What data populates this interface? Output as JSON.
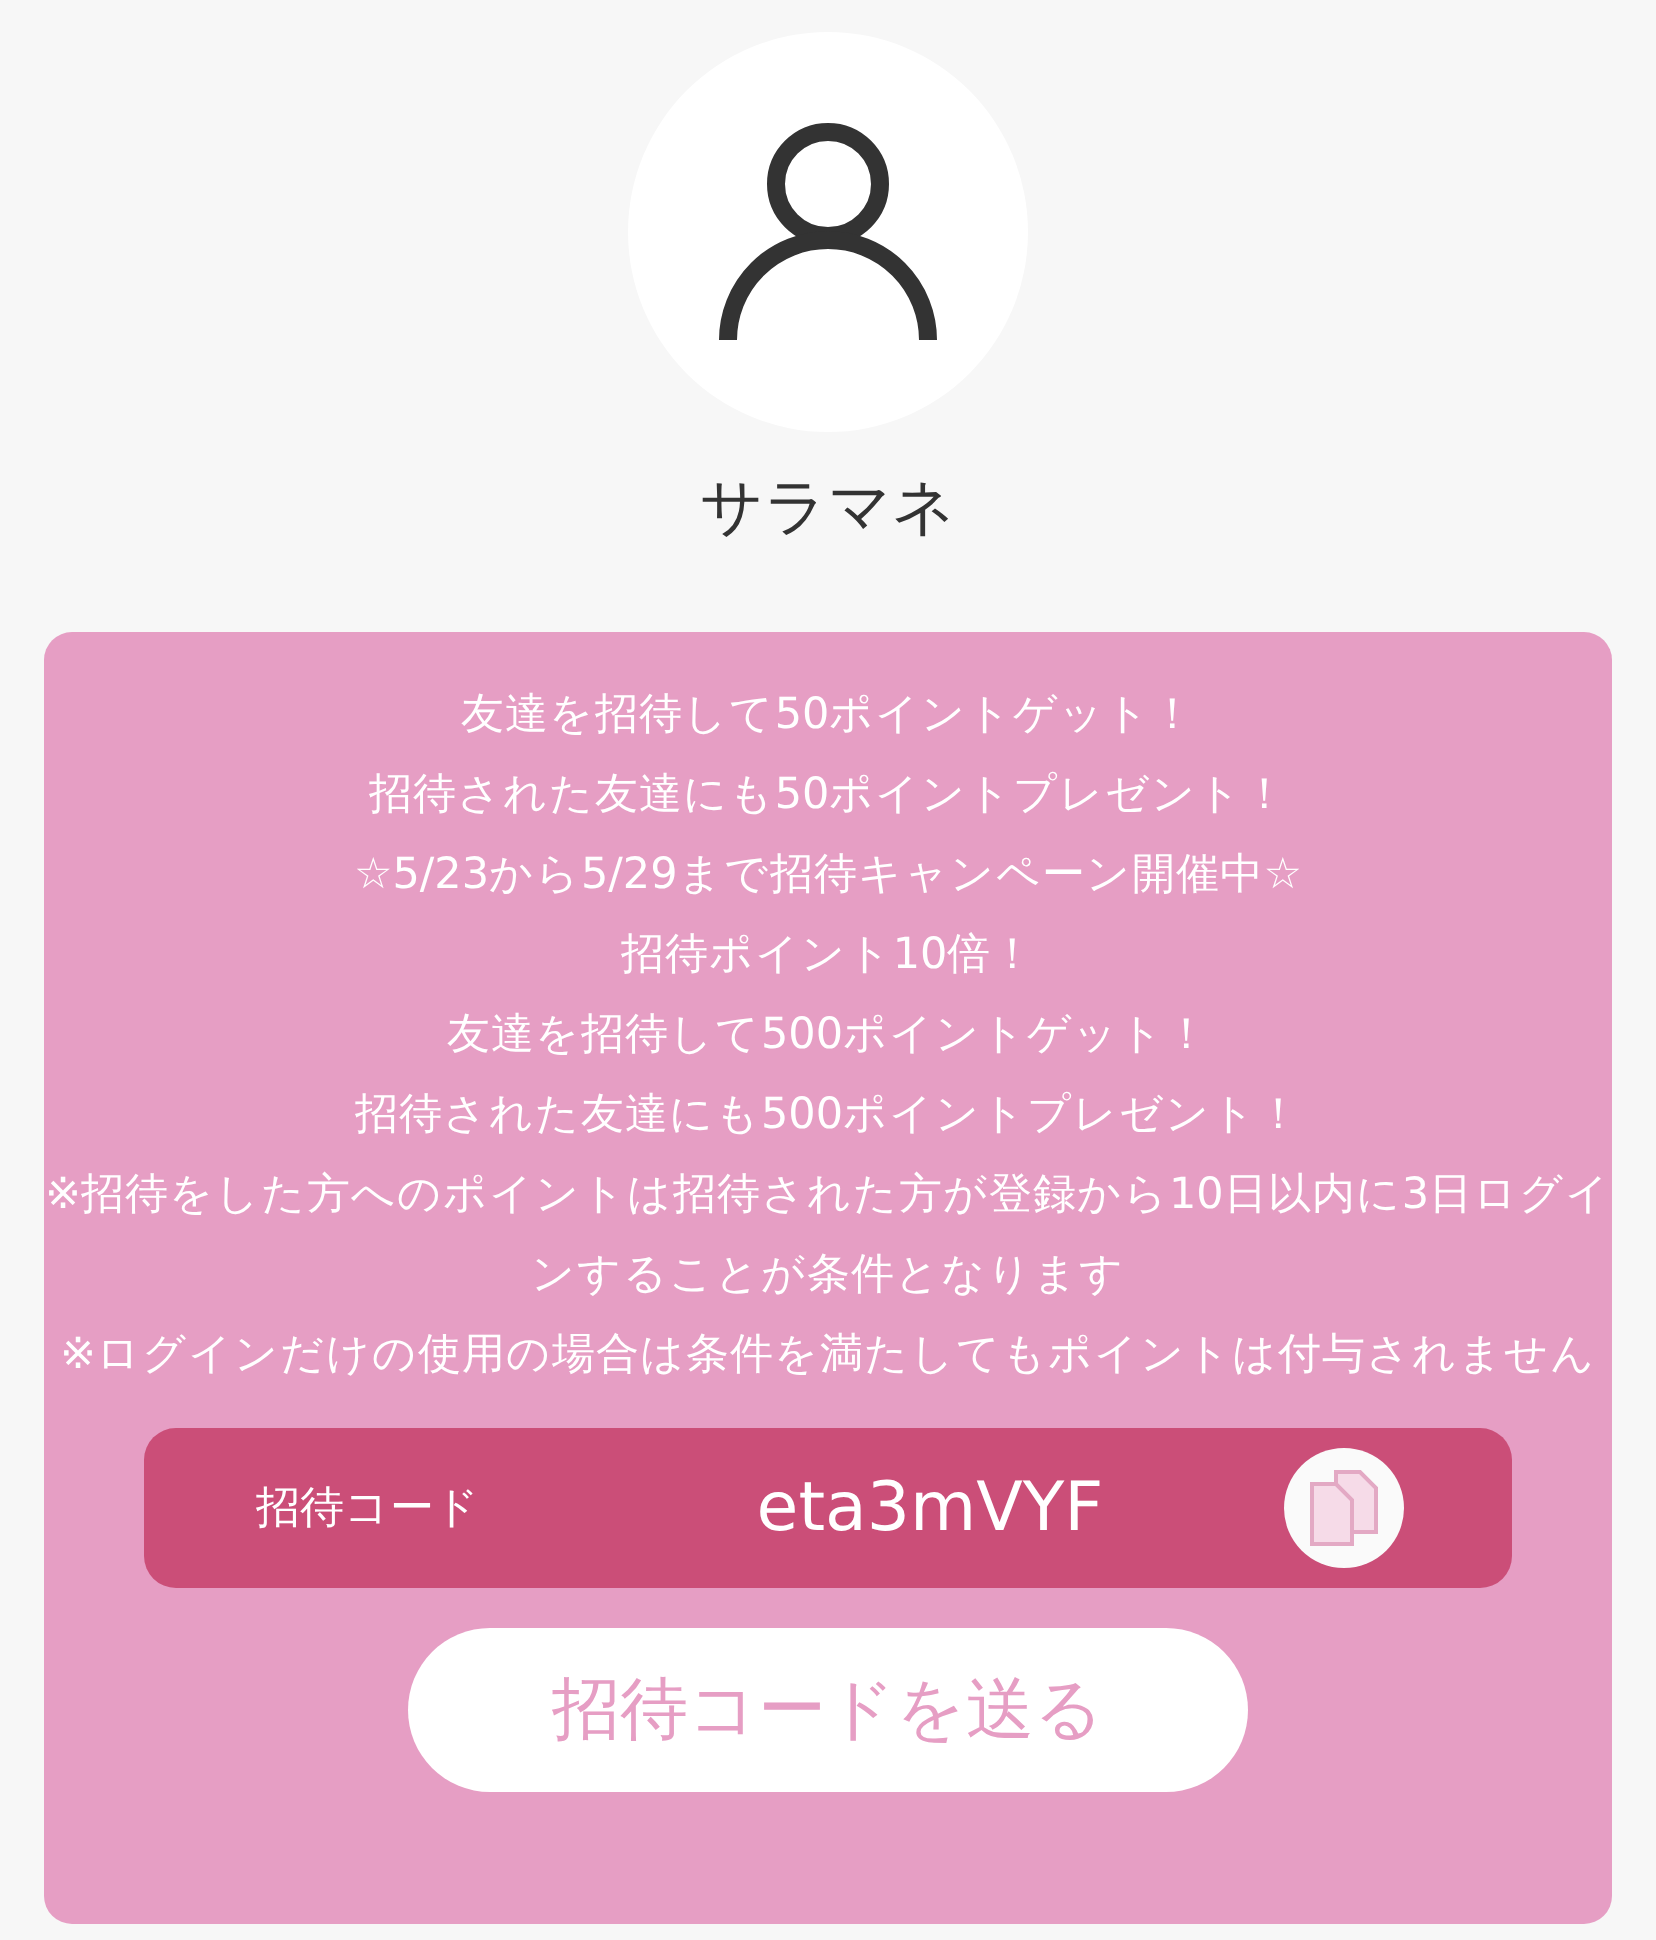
{
  "profile": {
    "name": "サラマネ"
  },
  "invite": {
    "messages": [
      "友達を招待して50ポイントゲット！",
      "招待された友達にも50ポイントプレゼント！",
      "☆5/23から5/29まで招待キャンペーン開催中☆",
      "招待ポイント10倍！",
      "友達を招待して500ポイントゲット！",
      "招待された友達にも500ポイントプレゼント！",
      "※招待をした方へのポイントは招待された方が登録から10日以内に3日ログインすることが条件となります",
      "※ログインだけの使用の場合は条件を満たしてもポイントは付与されません"
    ],
    "code_label": "招待コード",
    "code": "eta3mVYF",
    "send_button": "招待コードを送る"
  }
}
